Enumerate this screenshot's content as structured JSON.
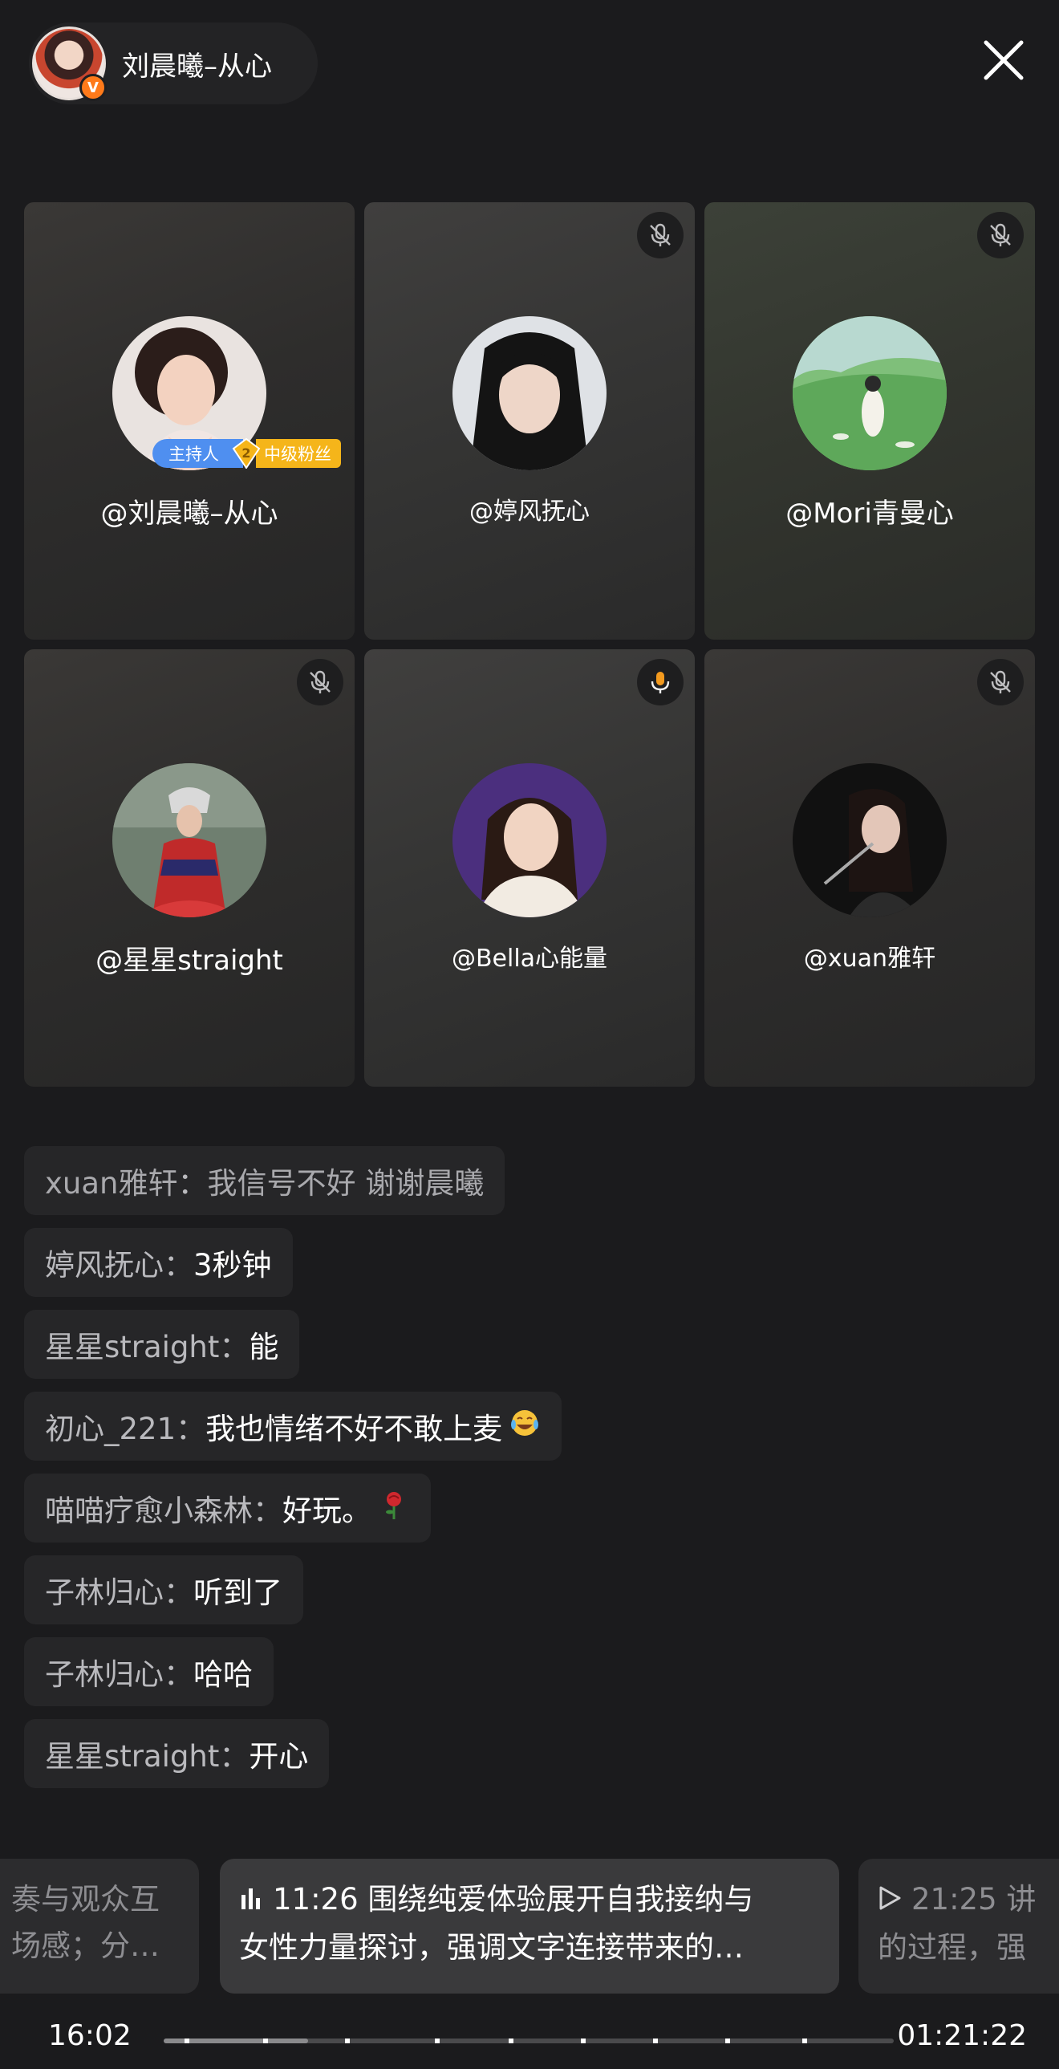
{
  "host": {
    "name": "刘晨曦–从心",
    "verified_badge": "V",
    "accent_color": "#ff7a1a"
  },
  "close_icon": "close-icon",
  "speakers": [
    {
      "name": "@刘晨曦–从心",
      "mic": "host",
      "tags": {
        "role": "主持人",
        "level": "2",
        "fan": "中级粉丝"
      }
    },
    {
      "name": "@婷风抚心",
      "mic": "muted"
    },
    {
      "name": "@Mori青曼心",
      "mic": "muted"
    },
    {
      "name": "@星星straight",
      "mic": "muted"
    },
    {
      "name": "@Bella心能量",
      "mic": "active"
    },
    {
      "name": "@xuan雅轩",
      "mic": "muted"
    }
  ],
  "chat": [
    {
      "user": "xuan雅轩",
      "sep": "：",
      "msg": "我信号不好 谢谢晨曦",
      "faded": true
    },
    {
      "user": "婷风抚心",
      "sep": "：",
      "msg": "3秒钟"
    },
    {
      "user": "星星straight",
      "sep": "：",
      "msg": "能"
    },
    {
      "user": "初心_221",
      "sep": "：",
      "msg": "我也情绪不好不敢上麦",
      "emoji": "laughing-crying-emoji"
    },
    {
      "user": "喵喵疗愈小森林",
      "sep": "：",
      "msg": "好玩。",
      "emoji": "rose-emoji"
    },
    {
      "user": "子林归心",
      "sep": "：",
      "msg": "听到了"
    },
    {
      "user": "子林归心",
      "sep": "：",
      "msg": "哈哈"
    },
    {
      "user": "星星straight",
      "sep": "：",
      "msg": "开心"
    }
  ],
  "chapters": {
    "left": {
      "line1": "奏与观众互",
      "line2": "场感；分…"
    },
    "current": {
      "time": "11:26",
      "line1": "围绕纯爱体验展开自我接纳与",
      "line2": "女性力量探讨，强调文字连接带来的…"
    },
    "right": {
      "time": "21:25",
      "line1": "讲",
      "line2": "的过程，强"
    }
  },
  "player": {
    "current_time": "16:02",
    "total_time": "01:21:22",
    "progress_fraction": 0.198
  }
}
